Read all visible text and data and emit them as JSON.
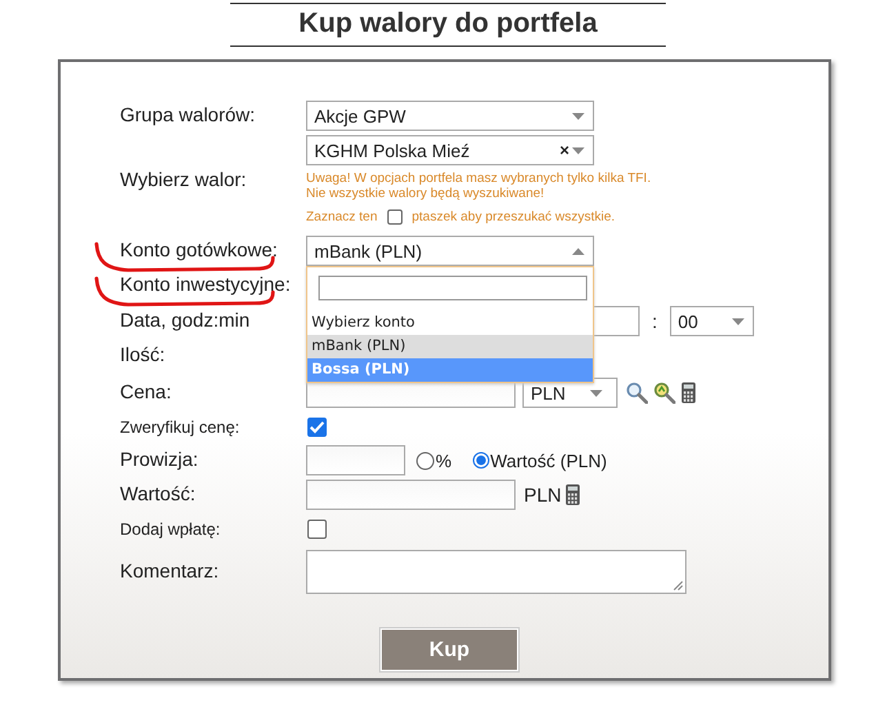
{
  "title": "Kup walory do portfela",
  "fields": [
    {
      "kind": "select",
      "label": "Grupa walorów:",
      "value": "Akcje GPW"
    },
    {
      "kind": "security",
      "label": "Wybierz walor:",
      "value": "KGHM Polska Mieź",
      "clear": "×",
      "warning": [
        "Uwaga! W opcjach portfela masz wybranych tylko kilka TFI.",
        "Nie wszystkie walory będą wyszukiwane!"
      ],
      "search_all": {
        "before": "Zaznacz ten",
        "after": "ptaszek aby przeszukać wszystkie.",
        "checked": false
      }
    },
    {
      "kind": "select",
      "label": "Konto gotówkowe:",
      "value": "mBank (PLN)",
      "underlined": true,
      "expanded": true,
      "options": [
        {
          "label": "Wybierz konto",
          "selected": false,
          "highlighted": false
        },
        {
          "label": "mBank (PLN)",
          "selected": true,
          "highlighted": false
        },
        {
          "label": "Bossa (PLN)",
          "selected": false,
          "highlighted": true
        }
      ]
    },
    {
      "kind": "select",
      "label": "Konto inwestycyjne:",
      "underlined": true
    },
    {
      "kind": "datetime",
      "label": "Data, godz:min",
      "separator": ":",
      "minute": "00"
    },
    {
      "kind": "input",
      "label": "Ilość:"
    },
    {
      "kind": "price",
      "label": "Cena:",
      "currency": "PLN"
    },
    {
      "kind": "checkbox",
      "label": "Zweryfikuj cenę:",
      "checked": true
    },
    {
      "kind": "commission",
      "label": "Prowizja:",
      "options": [
        {
          "label": "%",
          "selected": false
        },
        {
          "label": "Wartość (PLN)",
          "selected": true
        }
      ]
    },
    {
      "kind": "value",
      "label": "Wartość:",
      "unit": "PLN"
    },
    {
      "kind": "checkbox",
      "label": "Dodaj wpłatę:",
      "checked": false
    },
    {
      "kind": "textarea",
      "label": "Komentarz:"
    }
  ],
  "button": "Kup"
}
